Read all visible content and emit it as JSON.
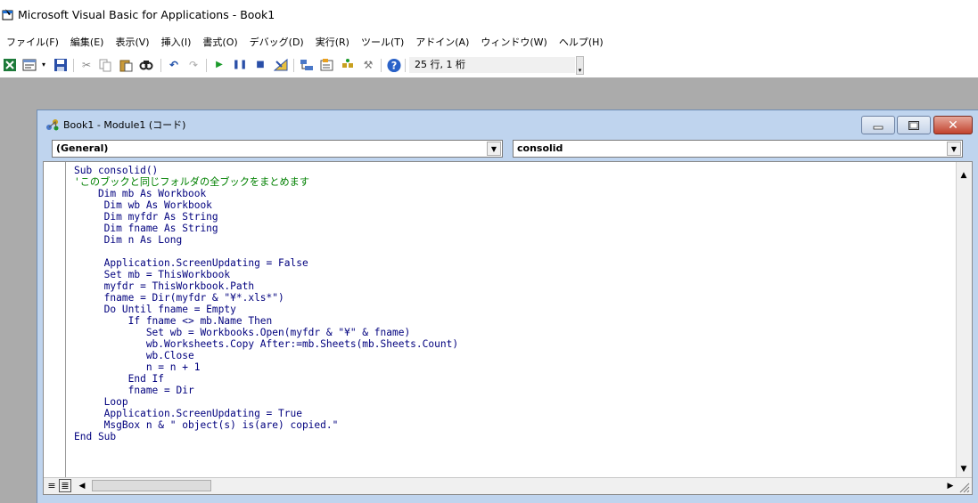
{
  "window": {
    "title": "Microsoft Visual Basic for Applications - Book1"
  },
  "menubar": {
    "items": [
      {
        "label": "ファイル(F)"
      },
      {
        "label": "編集(E)"
      },
      {
        "label": "表示(V)"
      },
      {
        "label": "挿入(I)"
      },
      {
        "label": "書式(O)"
      },
      {
        "label": "デバッグ(D)"
      },
      {
        "label": "実行(R)"
      },
      {
        "label": "ツール(T)"
      },
      {
        "label": "アドイン(A)"
      },
      {
        "label": "ウィンドウ(W)"
      },
      {
        "label": "ヘルプ(H)"
      }
    ]
  },
  "toolbar": {
    "cursor_position": "25 行, 1 桁",
    "icons": [
      "view-excel-icon",
      "insert-module-icon",
      "save-icon",
      "cut-icon",
      "copy-icon",
      "paste-icon",
      "find-icon",
      "undo-icon",
      "redo-icon",
      "run-icon",
      "break-icon",
      "reset-icon",
      "design-mode-icon",
      "project-explorer-icon",
      "properties-icon",
      "object-browser-icon",
      "toolbox-icon",
      "help-icon"
    ]
  },
  "code_window": {
    "title": "Book1 - Module1 (コード)",
    "object_dropdown": "(General)",
    "procedure_dropdown": "consolid",
    "code_lines": [
      {
        "text": "Sub consolid()",
        "type": "code"
      },
      {
        "text": "'このブックと同じフォルダの全ブックをまとめます",
        "type": "comment"
      },
      {
        "text": "    Dim mb As Workbook",
        "type": "code"
      },
      {
        "text": "     Dim wb As Workbook",
        "type": "code"
      },
      {
        "text": "     Dim myfdr As String",
        "type": "code"
      },
      {
        "text": "     Dim fname As String",
        "type": "code"
      },
      {
        "text": "     Dim n As Long",
        "type": "code"
      },
      {
        "text": "",
        "type": "code"
      },
      {
        "text": "     Application.ScreenUpdating = False",
        "type": "code"
      },
      {
        "text": "     Set mb = ThisWorkbook",
        "type": "code"
      },
      {
        "text": "     myfdr = ThisWorkbook.Path",
        "type": "code"
      },
      {
        "text": "     fname = Dir(myfdr & \"¥*.xls*\")",
        "type": "code"
      },
      {
        "text": "     Do Until fname = Empty",
        "type": "code"
      },
      {
        "text": "         If fname <> mb.Name Then",
        "type": "code"
      },
      {
        "text": "            Set wb = Workbooks.Open(myfdr & \"¥\" & fname)",
        "type": "code"
      },
      {
        "text": "            wb.Worksheets.Copy After:=mb.Sheets(mb.Sheets.Count)",
        "type": "code"
      },
      {
        "text": "            wb.Close",
        "type": "code"
      },
      {
        "text": "            n = n + 1",
        "type": "code"
      },
      {
        "text": "         End If",
        "type": "code"
      },
      {
        "text": "         fname = Dir",
        "type": "code"
      },
      {
        "text": "     Loop",
        "type": "code"
      },
      {
        "text": "     Application.ScreenUpdating = True",
        "type": "code"
      },
      {
        "text": "     MsgBox n & \" object(s) is(are) copied.\"",
        "type": "code"
      },
      {
        "text": "End Sub",
        "type": "code"
      }
    ]
  },
  "colors": {
    "code_keyword": "#00007e",
    "code_comment": "#008000",
    "workspace_bg": "#ababab",
    "window_frame": "#bfd4ee"
  }
}
